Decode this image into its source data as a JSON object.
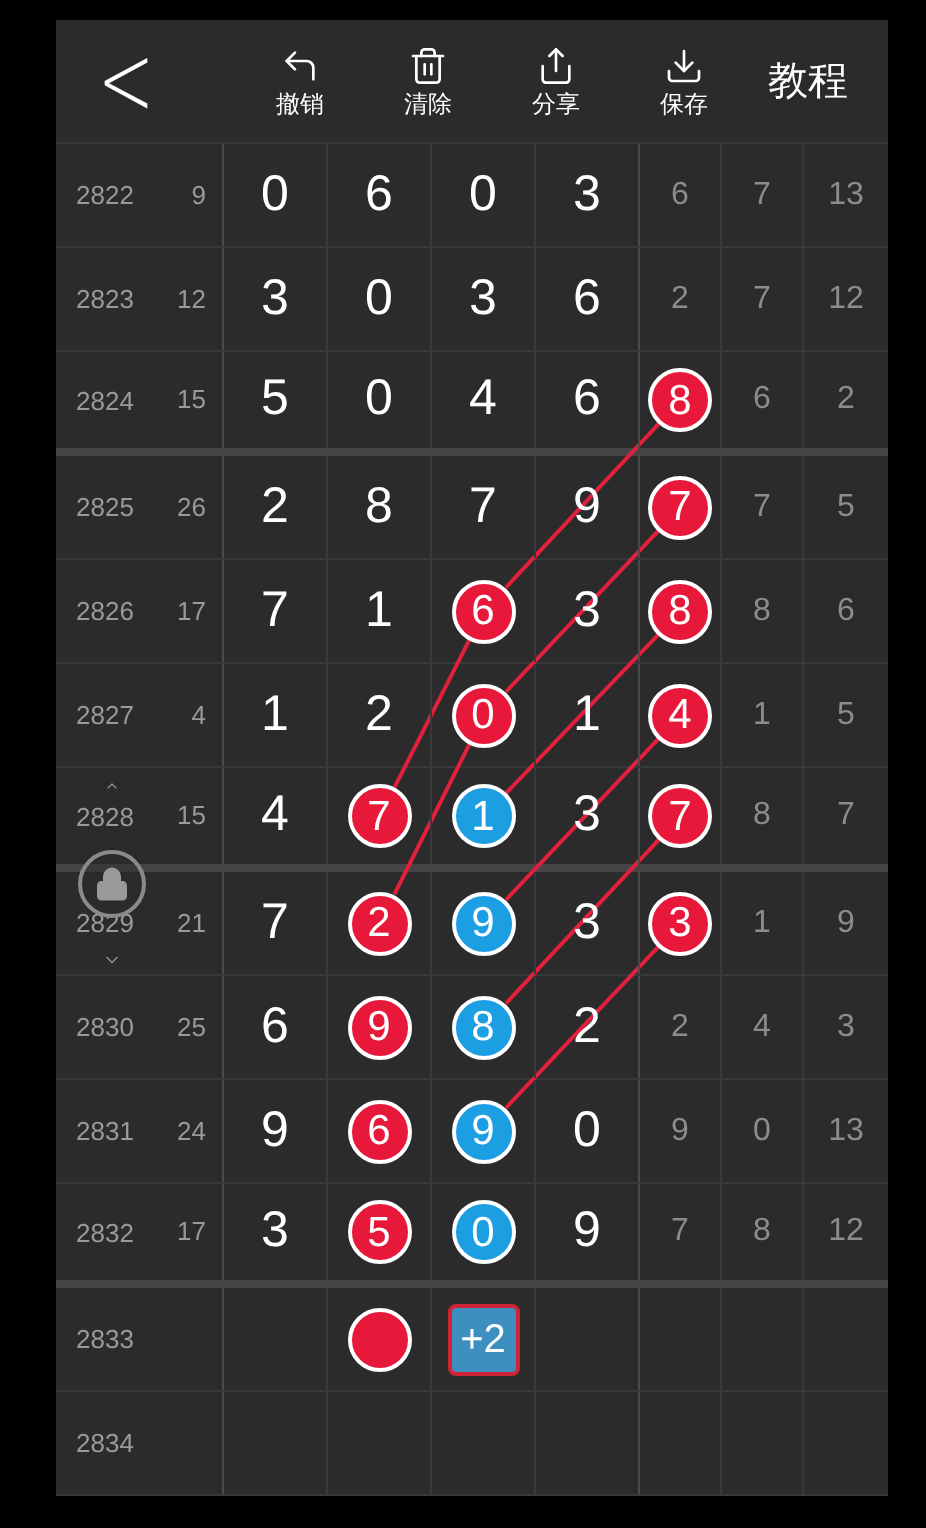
{
  "toolbar": {
    "back": "<",
    "actions": [
      {
        "kind": "undo",
        "label": "撤销"
      },
      {
        "kind": "trash",
        "label": "清除"
      },
      {
        "kind": "share",
        "label": "分享"
      },
      {
        "kind": "save",
        "label": "保存"
      }
    ],
    "help": "教程"
  },
  "rows": [
    {
      "issue": "2822",
      "count": "9",
      "cells": [
        {
          "kind": "plain",
          "text": "0"
        },
        {
          "kind": "plain",
          "text": "6"
        },
        {
          "kind": "plain",
          "text": "0"
        },
        {
          "kind": "plain",
          "text": "3"
        },
        {
          "kind": "plain",
          "text": "6"
        },
        {
          "kind": "plain",
          "text": "7"
        },
        {
          "kind": "plain",
          "text": "13"
        }
      ]
    },
    {
      "issue": "2823",
      "count": "12",
      "cells": [
        {
          "kind": "plain",
          "text": "3"
        },
        {
          "kind": "plain",
          "text": "0"
        },
        {
          "kind": "plain",
          "text": "3"
        },
        {
          "kind": "plain",
          "text": "6"
        },
        {
          "kind": "plain",
          "text": "2"
        },
        {
          "kind": "plain",
          "text": "7"
        },
        {
          "kind": "plain",
          "text": "12"
        }
      ]
    },
    {
      "issue": "2824",
      "count": "15",
      "section_end": true,
      "cells": [
        {
          "kind": "plain",
          "text": "5"
        },
        {
          "kind": "plain",
          "text": "0"
        },
        {
          "kind": "plain",
          "text": "4"
        },
        {
          "kind": "plain",
          "text": "6"
        },
        {
          "kind": "red",
          "text": "8"
        },
        {
          "kind": "plain",
          "text": "6"
        },
        {
          "kind": "plain",
          "text": "2"
        }
      ]
    },
    {
      "issue": "2825",
      "count": "26",
      "cells": [
        {
          "kind": "plain",
          "text": "2"
        },
        {
          "kind": "plain",
          "text": "8"
        },
        {
          "kind": "plain",
          "text": "7"
        },
        {
          "kind": "plain",
          "text": "9"
        },
        {
          "kind": "red",
          "text": "7"
        },
        {
          "kind": "plain",
          "text": "7"
        },
        {
          "kind": "plain",
          "text": "5"
        }
      ]
    },
    {
      "issue": "2826",
      "count": "17",
      "cells": [
        {
          "kind": "plain",
          "text": "7"
        },
        {
          "kind": "plain",
          "text": "1"
        },
        {
          "kind": "red",
          "text": "6"
        },
        {
          "kind": "plain",
          "text": "3"
        },
        {
          "kind": "red",
          "text": "8"
        },
        {
          "kind": "plain",
          "text": "8"
        },
        {
          "kind": "plain",
          "text": "6"
        }
      ]
    },
    {
      "issue": "2827",
      "count": "4",
      "cells": [
        {
          "kind": "plain",
          "text": "1"
        },
        {
          "kind": "plain",
          "text": "2"
        },
        {
          "kind": "red",
          "text": "0"
        },
        {
          "kind": "plain",
          "text": "1"
        },
        {
          "kind": "red",
          "text": "4"
        },
        {
          "kind": "plain",
          "text": "1"
        },
        {
          "kind": "plain",
          "text": "5"
        }
      ]
    },
    {
      "issue": "2828",
      "count": "15",
      "section_end": true,
      "cells": [
        {
          "kind": "plain",
          "text": "4"
        },
        {
          "kind": "red",
          "text": "7"
        },
        {
          "kind": "blue",
          "text": "1"
        },
        {
          "kind": "plain",
          "text": "3"
        },
        {
          "kind": "red",
          "text": "7"
        },
        {
          "kind": "plain",
          "text": "8"
        },
        {
          "kind": "plain",
          "text": "7"
        }
      ]
    },
    {
      "issue": "2829",
      "count": "21",
      "cells": [
        {
          "kind": "plain",
          "text": "7"
        },
        {
          "kind": "red",
          "text": "2"
        },
        {
          "kind": "blue",
          "text": "9"
        },
        {
          "kind": "plain",
          "text": "3"
        },
        {
          "kind": "red",
          "text": "3"
        },
        {
          "kind": "plain",
          "text": "1"
        },
        {
          "kind": "plain",
          "text": "9"
        }
      ]
    },
    {
      "issue": "2830",
      "count": "25",
      "cells": [
        {
          "kind": "plain",
          "text": "6"
        },
        {
          "kind": "red",
          "text": "9"
        },
        {
          "kind": "blue",
          "text": "8"
        },
        {
          "kind": "plain",
          "text": "2"
        },
        {
          "kind": "plain",
          "text": "2"
        },
        {
          "kind": "plain",
          "text": "4"
        },
        {
          "kind": "plain",
          "text": "3"
        }
      ]
    },
    {
      "issue": "2831",
      "count": "24",
      "cells": [
        {
          "kind": "plain",
          "text": "9"
        },
        {
          "kind": "red",
          "text": "6"
        },
        {
          "kind": "blue",
          "text": "9"
        },
        {
          "kind": "plain",
          "text": "0"
        },
        {
          "kind": "plain",
          "text": "9"
        },
        {
          "kind": "plain",
          "text": "0"
        },
        {
          "kind": "plain",
          "text": "13"
        }
      ]
    },
    {
      "issue": "2832",
      "count": "17",
      "section_end": true,
      "cells": [
        {
          "kind": "plain",
          "text": "3"
        },
        {
          "kind": "red",
          "text": "5"
        },
        {
          "kind": "blue",
          "text": "0"
        },
        {
          "kind": "plain",
          "text": "9"
        },
        {
          "kind": "plain",
          "text": "7"
        },
        {
          "kind": "plain",
          "text": "8"
        },
        {
          "kind": "plain",
          "text": "12"
        }
      ]
    },
    {
      "issue": "2833",
      "cells": [
        {
          "kind": "blank"
        },
        {
          "kind": "red"
        },
        {
          "kind": "chip",
          "text": "+2"
        },
        {
          "kind": "blank"
        },
        {
          "kind": "blank"
        },
        {
          "kind": "blank"
        },
        {
          "kind": "blank"
        }
      ]
    },
    {
      "issue": "2834",
      "cells": [
        {
          "kind": "blank"
        },
        {
          "kind": "blank"
        },
        {
          "kind": "blank"
        },
        {
          "kind": "blank"
        },
        {
          "kind": "blank"
        },
        {
          "kind": "blank"
        },
        {
          "kind": "blank"
        }
      ]
    }
  ],
  "lock": {
    "locked": true
  }
}
